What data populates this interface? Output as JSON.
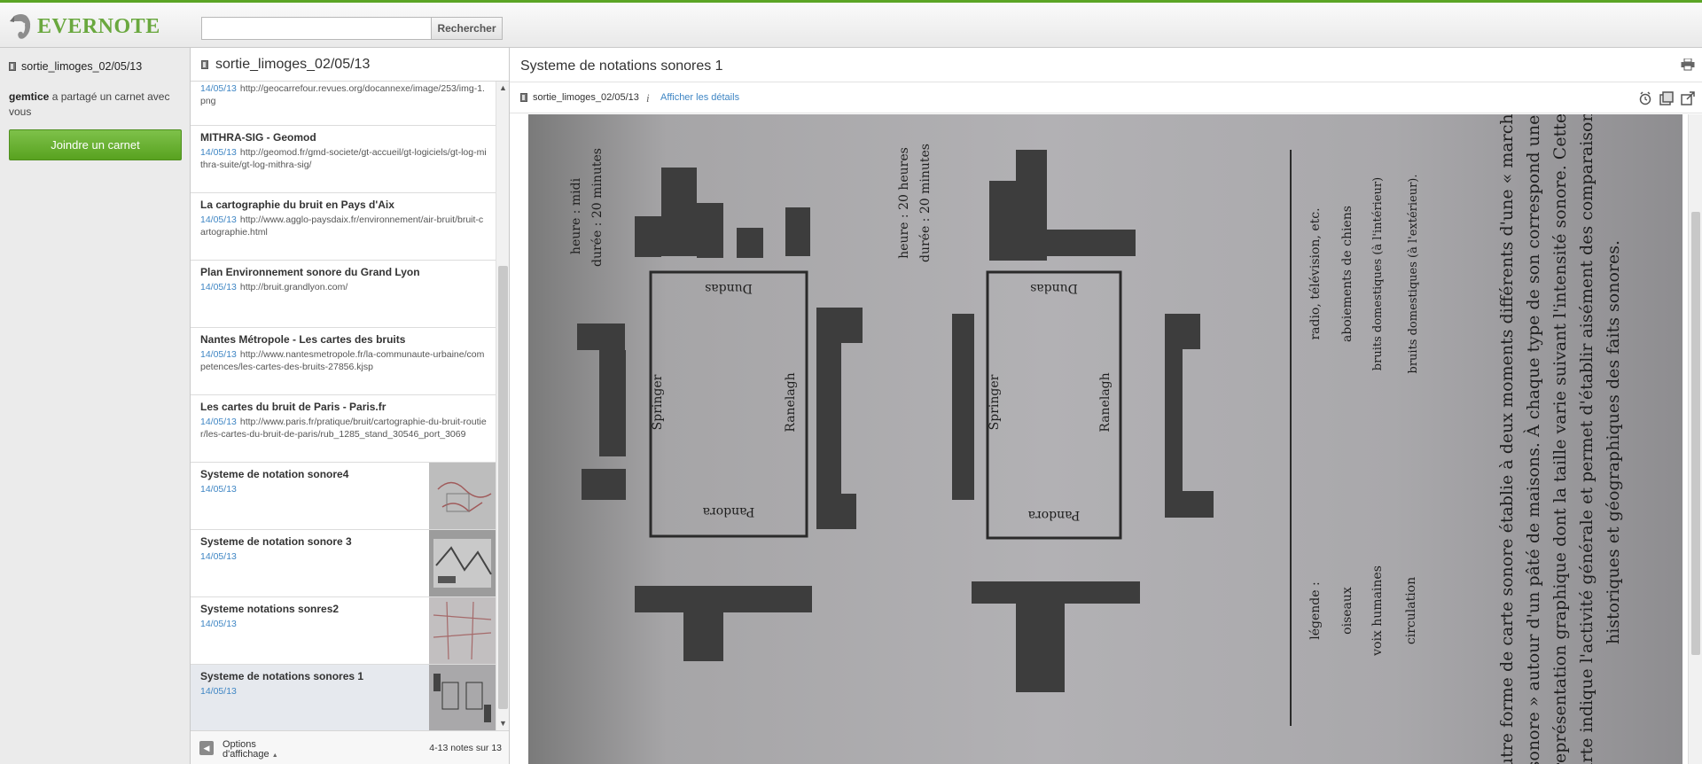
{
  "app": {
    "logo_text": "EVERNOTE"
  },
  "search": {
    "placeholder": "",
    "button_label": "Rechercher"
  },
  "sidebar": {
    "notebook_name": "sortie_limoges_02/05/13",
    "share_user": "gemtice",
    "share_text": " a partagé un carnet avec vous",
    "join_button": "Joindre un carnet"
  },
  "notelist": {
    "header": "sortie_limoges_02/05/13",
    "notes": [
      {
        "title": "",
        "date": "14/05/13",
        "url": "http://geocarrefour.revues.org/docannexe/image/253/img-1.png"
      },
      {
        "title": "MITHRA-SIG - Geomod",
        "date": "14/05/13",
        "url": "http://geomod.fr/gmd-societe/gt-accueil/gt-logiciels/gt-log-mithra-suite/gt-log-mithra-sig/"
      },
      {
        "title": "La cartographie du bruit en Pays d'Aix",
        "date": "14/05/13",
        "url": "http://www.agglo-paysdaix.fr/environnement/air-bruit/bruit-cartographie.html"
      },
      {
        "title": "Plan Environnement sonore du Grand Lyon",
        "date": "14/05/13",
        "url": "http://bruit.grandlyon.com/"
      },
      {
        "title": "Nantes Métropole - Les cartes des bruits",
        "date": "14/05/13",
        "url": "http://www.nantesmetropole.fr/la-communaute-urbaine/competences/les-cartes-des-bruits-27856.kjsp"
      },
      {
        "title": "Les cartes du bruit de Paris - Paris.fr",
        "date": "14/05/13",
        "url": "http://www.paris.fr/pratique/bruit/cartographie-du-bruit-routier/les-cartes-du-bruit-de-paris/rub_1285_stand_30546_port_3069"
      },
      {
        "title": "Systeme de notation sonore4",
        "date": "14/05/13",
        "url": ""
      },
      {
        "title": "Systeme de notation sonore 3",
        "date": "14/05/13",
        "url": ""
      },
      {
        "title": "Systeme notations sonres2",
        "date": "14/05/13",
        "url": ""
      },
      {
        "title": "Systeme de notations sonores 1",
        "date": "14/05/13",
        "url": ""
      }
    ],
    "footer_options": "Options d'affichage",
    "note_count": "4-13 notes sur 13"
  },
  "note": {
    "title": "Systeme de notations sonores 1",
    "notebook": "sortie_limoges_02/05/13",
    "details_link": "Afficher les détails",
    "image": {
      "heure_1": "heure : midi",
      "duree_1": "durée : 20 minutes",
      "heure_2": "heure : 20 heures",
      "duree_2": "durée : 20 minutes",
      "street_top": "Dundas",
      "street_bottom": "Pandora",
      "street_left": "Springer",
      "street_right": "Ranelagh",
      "legend_title": "légende :",
      "legend_items": [
        "oiseaux",
        "voix humaines",
        "circulation",
        "radio, télévision, etc.",
        "aboiements de chiens",
        "bruits domestiques (à l'intérieur)",
        "bruits domestiques (à l'extérieur)."
      ],
      "caption_lines": [
        "Autre forme de carte sonore établie à deux moments différents d'une « marche",
        "sonore » autour d'un pâté de maisons. À chaque type de son correspond une",
        "représentation graphique dont la taille varie suivant l'intensité sonore. Cette",
        "carte indique l'activité générale et permet d'établir aisément des comparaisons",
        "historiques et géographiques des faits sonores."
      ]
    }
  }
}
